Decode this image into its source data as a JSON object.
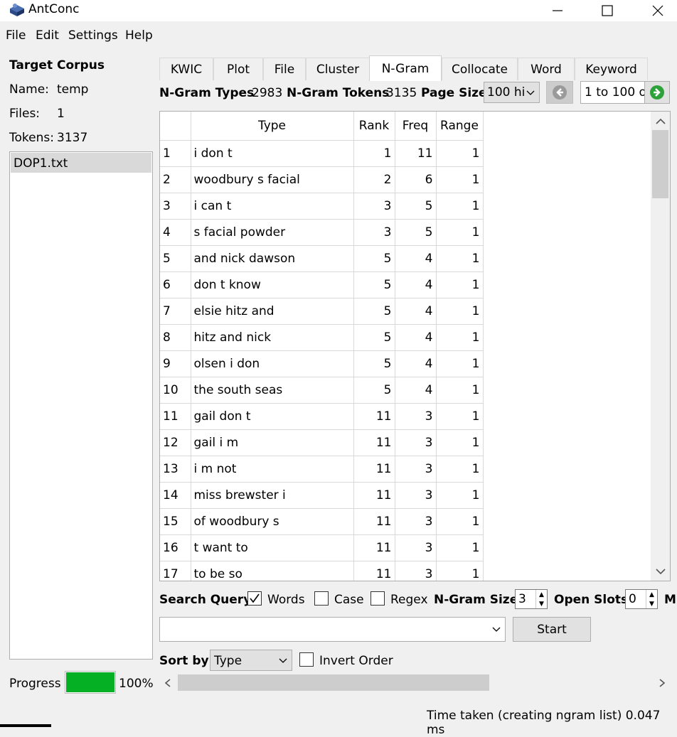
{
  "window": {
    "title": "AntConc"
  },
  "menu": [
    "File",
    "Edit",
    "Settings",
    "Help"
  ],
  "corpus": {
    "title": "Target Corpus",
    "name_label": "Name:",
    "name_value": "temp",
    "files_label": "Files:",
    "files_value": "1",
    "tokens_label": "Tokens:",
    "tokens_value": "3137",
    "files": [
      "DOP1.txt"
    ],
    "progress_label": "Progress",
    "progress_value": "100%",
    "progress_fraction": 1.0
  },
  "tabs": [
    "KWIC",
    "Plot",
    "File",
    "Cluster",
    "N-Gram",
    "Collocate",
    "Word",
    "Keyword"
  ],
  "active_tab": "N-Gram",
  "stats": {
    "types_label": "N-Gram Types",
    "types_value": "2983",
    "tokens_label": "N-Gram Tokens",
    "tokens_value": "3135",
    "page_size_label": "Page Size",
    "page_size_value": "100 hi",
    "page_range": "1 to 100 o"
  },
  "table": {
    "headers": [
      "",
      "Type",
      "Rank",
      "Freq",
      "Range"
    ],
    "rows": [
      [
        "1",
        "i don t",
        "1",
        "11",
        "1"
      ],
      [
        "2",
        "woodbury s facial",
        "2",
        "6",
        "1"
      ],
      [
        "3",
        "i can t",
        "3",
        "5",
        "1"
      ],
      [
        "4",
        "s facial powder",
        "3",
        "5",
        "1"
      ],
      [
        "5",
        "and nick dawson",
        "5",
        "4",
        "1"
      ],
      [
        "6",
        "don t know",
        "5",
        "4",
        "1"
      ],
      [
        "7",
        "elsie hitz and",
        "5",
        "4",
        "1"
      ],
      [
        "8",
        "hitz and nick",
        "5",
        "4",
        "1"
      ],
      [
        "9",
        "olsen i don",
        "5",
        "4",
        "1"
      ],
      [
        "10",
        "the south seas",
        "5",
        "4",
        "1"
      ],
      [
        "11",
        "gail don t",
        "11",
        "3",
        "1"
      ],
      [
        "12",
        "gail i m",
        "11",
        "3",
        "1"
      ],
      [
        "13",
        "i m not",
        "11",
        "3",
        "1"
      ],
      [
        "14",
        "miss brewster i",
        "11",
        "3",
        "1"
      ],
      [
        "15",
        "of woodbury s",
        "11",
        "3",
        "1"
      ],
      [
        "16",
        "t want to",
        "11",
        "3",
        "1"
      ],
      [
        "17",
        "to be so",
        "11",
        "3",
        "1"
      ]
    ]
  },
  "search": {
    "label": "Search Query",
    "words_label": "Words",
    "words_checked": true,
    "case_label": "Case",
    "case_checked": false,
    "regex_label": "Regex",
    "regex_checked": false,
    "ngram_size_label": "N-Gram Size",
    "ngram_size_value": "3",
    "open_slots_label": "Open Slots",
    "open_slots_value": "0",
    "cut_label": "M",
    "query_value": "",
    "start_label": "Start"
  },
  "sort": {
    "label": "Sort by",
    "value": "Type",
    "invert_label": "Invert Order",
    "invert_checked": false
  },
  "status": "Time taken (creating ngram list) 0.047 ms"
}
